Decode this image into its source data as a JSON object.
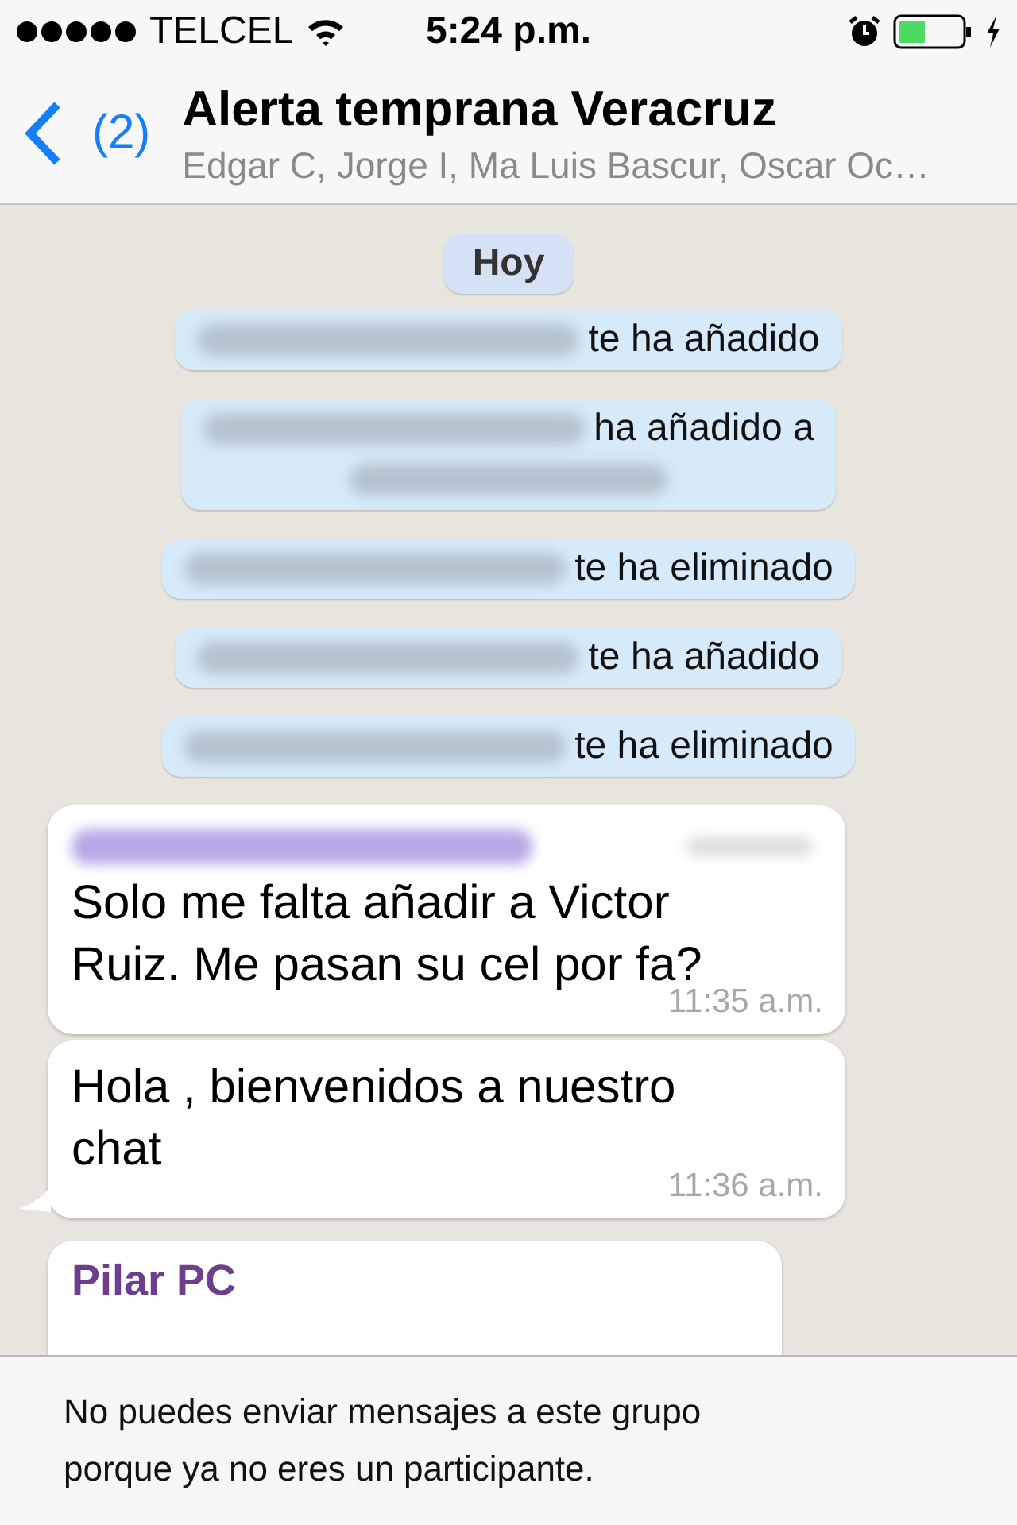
{
  "status_bar": {
    "carrier": "TELCEL",
    "time": "5:24 p.m."
  },
  "header": {
    "back_count": "(2)",
    "title": "Alerta temprana Veracruz",
    "members": "Edgar C, Jorge I, Ma Luis Bascur, Oscar Oc…"
  },
  "date_pill": "Hoy",
  "notices": [
    {
      "kind": "single",
      "text": "te ha añadido"
    },
    {
      "kind": "double",
      "text": "ha añadido a"
    },
    {
      "kind": "single",
      "text": "te ha eliminado"
    },
    {
      "kind": "single",
      "text": "te ha añadido"
    },
    {
      "kind": "single",
      "text": "te ha eliminado"
    }
  ],
  "messages": [
    {
      "kind": "blurred_sender",
      "text": "Solo me falta añadir a Victor Ruiz. Me pasan su cel por fa?",
      "time": "11:35 a.m.",
      "tail": false
    },
    {
      "kind": "plain",
      "text": "Hola , bienvenidos a nuestro chat",
      "time": "11:36 a.m.",
      "tail": true
    },
    {
      "kind": "named_sender",
      "sender": "Pilar PC",
      "tail": false
    }
  ],
  "footer": "No puedes enviar mensajes a este grupo porque ya no eres un participante."
}
